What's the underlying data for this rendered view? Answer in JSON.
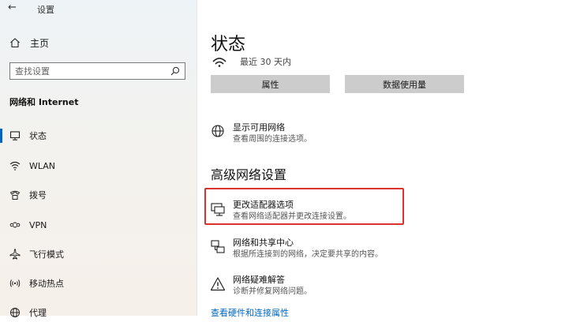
{
  "window": {
    "title": "设置",
    "back_icon": "back-arrow-icon"
  },
  "sidebar": {
    "home_label": "主页",
    "search_placeholder": "查找设置",
    "section_title": "网络和 Internet",
    "items": [
      {
        "label": "状态",
        "icon": "status-monitor-icon",
        "active": true
      },
      {
        "label": "WLAN",
        "icon": "wifi-icon",
        "active": false
      },
      {
        "label": "拨号",
        "icon": "dialup-icon",
        "active": false
      },
      {
        "label": "VPN",
        "icon": "vpn-icon",
        "active": false
      },
      {
        "label": "飞行模式",
        "icon": "airplane-icon",
        "active": false
      },
      {
        "label": "移动热点",
        "icon": "hotspot-icon",
        "active": false
      },
      {
        "label": "代理",
        "icon": "proxy-globe-icon",
        "active": false
      }
    ]
  },
  "main": {
    "title": "状态",
    "connection_status": "最近 30 天内",
    "buttons": {
      "properties": "属性",
      "data_usage": "数据使用量"
    },
    "show_networks": {
      "title": "显示可用网络",
      "desc": "查看周围的连接选项。"
    },
    "advanced_title": "高级网络设置",
    "adapter": {
      "title": "更改适配器选项",
      "desc": "查看网络适配器并更改连接设置。"
    },
    "sharing_center": {
      "title": "网络和共享中心",
      "desc": "根据所连接到的网络，决定要共享的内容。"
    },
    "troubleshooter": {
      "title": "网络疑难解答",
      "desc": "诊断并修复网络问题。"
    },
    "hardware_link": "查看硬件和连接属性"
  },
  "colors": {
    "accent": "#0067c0",
    "highlight_border": "#d9332c",
    "button_bg": "#cccccc"
  }
}
